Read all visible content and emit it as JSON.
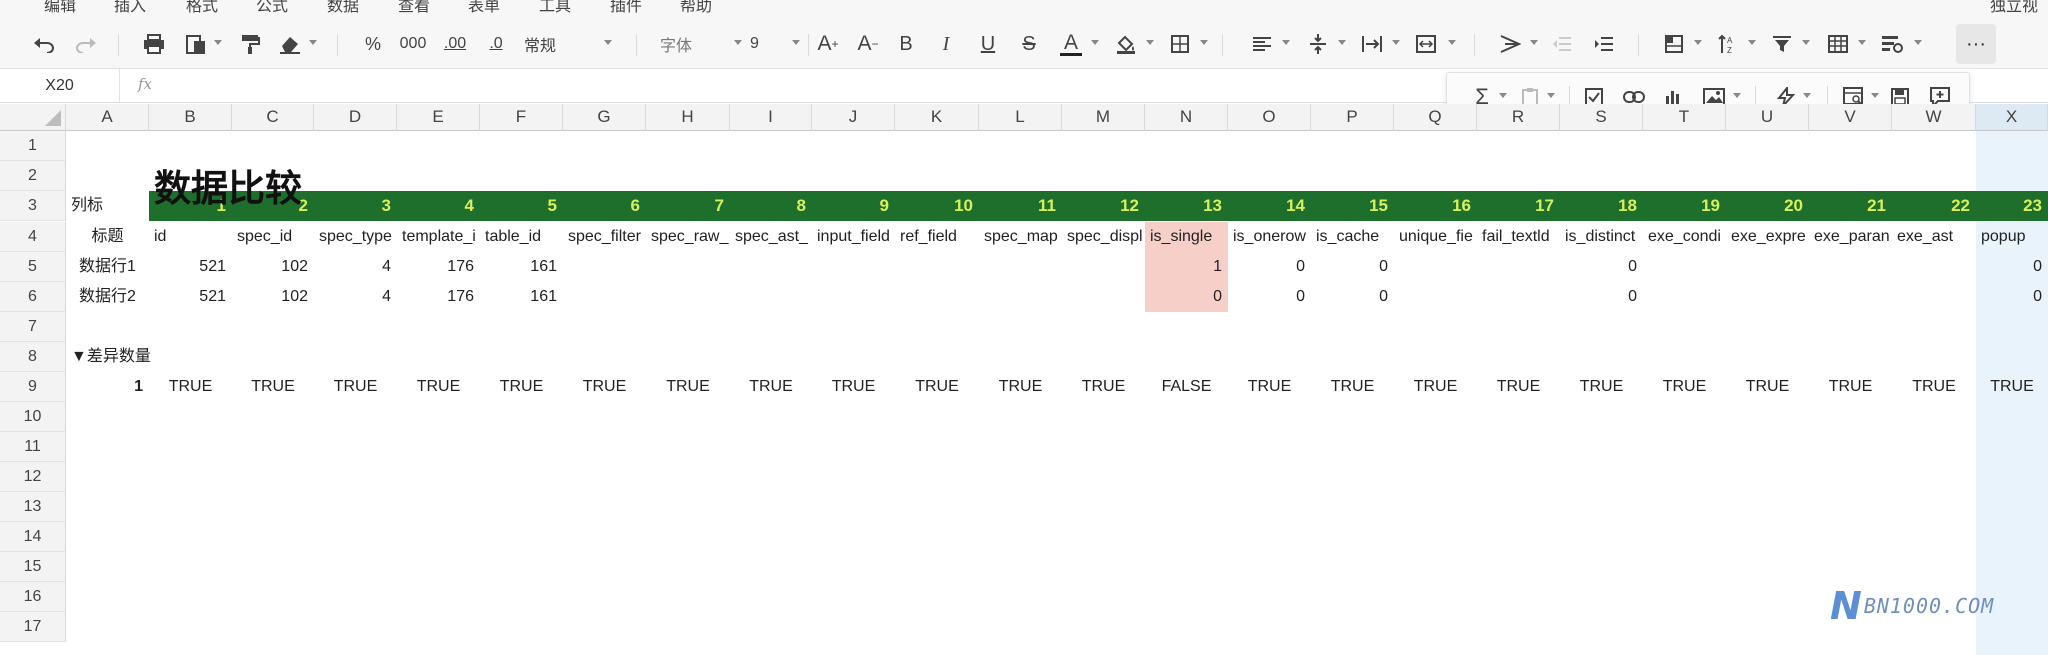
{
  "menu": [
    "编辑",
    "插入",
    "格式",
    "公式",
    "数据",
    "查看",
    "表单",
    "工具",
    "插件",
    "帮助"
  ],
  "menu_right": "独立视",
  "toolbar": {
    "number_format": "常规",
    "font_name": "字体",
    "font_size": "9",
    "percent": "%",
    "thousands": "000",
    "decimal_inc": ".00",
    "decimal_dec": ".0",
    "font_grow": "A",
    "font_shrink": "A",
    "bold": "B",
    "italic": "I",
    "underline": "U",
    "strike": "S",
    "font_color_letter": "A",
    "more": "···",
    "font_color_hex": "#222222",
    "icons": [
      "undo-icon",
      "redo-icon",
      "print-icon",
      "paste-icon",
      "format-painter-icon",
      "eraser-icon",
      "fill-color-icon",
      "borders-icon",
      "align-icon",
      "valign-icon",
      "wrap-icon",
      "merge-icon",
      "text-rotate-icon",
      "outdent-icon",
      "indent-icon",
      "freeze-icon",
      "sort-icon",
      "filter-icon",
      "table-icon",
      "conditional-format-icon"
    ]
  },
  "floating_toolbar": {
    "icons": [
      "sum-icon",
      "clipboard-icon",
      "checkbox-icon",
      "link-icon",
      "chart-icon",
      "image-icon",
      "flash-icon",
      "find-icon",
      "save-icon",
      "comment-icon"
    ]
  },
  "formula_bar": {
    "cell_ref": "X20",
    "fx": "fx",
    "value": ""
  },
  "columns": [
    "A",
    "B",
    "C",
    "D",
    "E",
    "F",
    "G",
    "H",
    "I",
    "J",
    "K",
    "L",
    "M",
    "N",
    "O",
    "P",
    "Q",
    "R",
    "S",
    "T",
    "U",
    "V",
    "W",
    "X"
  ],
  "selected_column": "X",
  "rows": [
    "1",
    "2",
    "3",
    "4",
    "5",
    "6",
    "7",
    "8",
    "9",
    "10",
    "11",
    "12",
    "13",
    "14",
    "15",
    "16",
    "17"
  ],
  "sheet": {
    "title": "数据比较",
    "row3_label": "列标",
    "col_numbers": [
      "1",
      "2",
      "3",
      "4",
      "5",
      "6",
      "7",
      "8",
      "9",
      "10",
      "11",
      "12",
      "13",
      "14",
      "15",
      "16",
      "17",
      "18",
      "19",
      "20",
      "21",
      "22",
      "23"
    ],
    "header_label": "标题",
    "headers": [
      "id",
      "spec_id",
      "spec_type",
      "template_i",
      "table_id",
      "spec_filter",
      "spec_raw_",
      "spec_ast_",
      "input_field",
      "ref_field",
      "spec_map",
      "spec_displ",
      "is_single",
      "is_onerow",
      "is_cache",
      "unique_fie",
      "fail_textld",
      "is_distinct",
      "exe_condi",
      "exe_expre",
      "exe_paran",
      "exe_ast",
      "popup"
    ],
    "row5_label": "数据行1",
    "row5": [
      "521",
      "102",
      "4",
      "176",
      "161",
      "",
      "",
      "",
      "",
      "",
      "",
      "",
      "1",
      "0",
      "0",
      "",
      "",
      "0",
      "",
      "",
      "",
      "",
      "0"
    ],
    "row6_label": "数据行2",
    "row6": [
      "521",
      "102",
      "4",
      "176",
      "161",
      "",
      "",
      "",
      "",
      "",
      "",
      "",
      "0",
      "0",
      "0",
      "",
      "",
      "0",
      "",
      "",
      "",
      "",
      "0"
    ],
    "diff_label": "▼差异数量",
    "diff_count": "1",
    "results": [
      "TRUE",
      "TRUE",
      "TRUE",
      "TRUE",
      "TRUE",
      "TRUE",
      "TRUE",
      "TRUE",
      "TRUE",
      "TRUE",
      "TRUE",
      "TRUE",
      "FALSE",
      "TRUE",
      "TRUE",
      "TRUE",
      "TRUE",
      "TRUE",
      "TRUE",
      "TRUE",
      "TRUE",
      "TRUE",
      "TRUE"
    ]
  },
  "colors": {
    "header_band": "#1e6e2c",
    "col_number_text": "#d8f05c",
    "diff_highlight": "#f7cfc9",
    "selected_column": "#e8f3fc"
  },
  "watermark": {
    "letter": "N",
    "text": "BN1000.COM"
  }
}
